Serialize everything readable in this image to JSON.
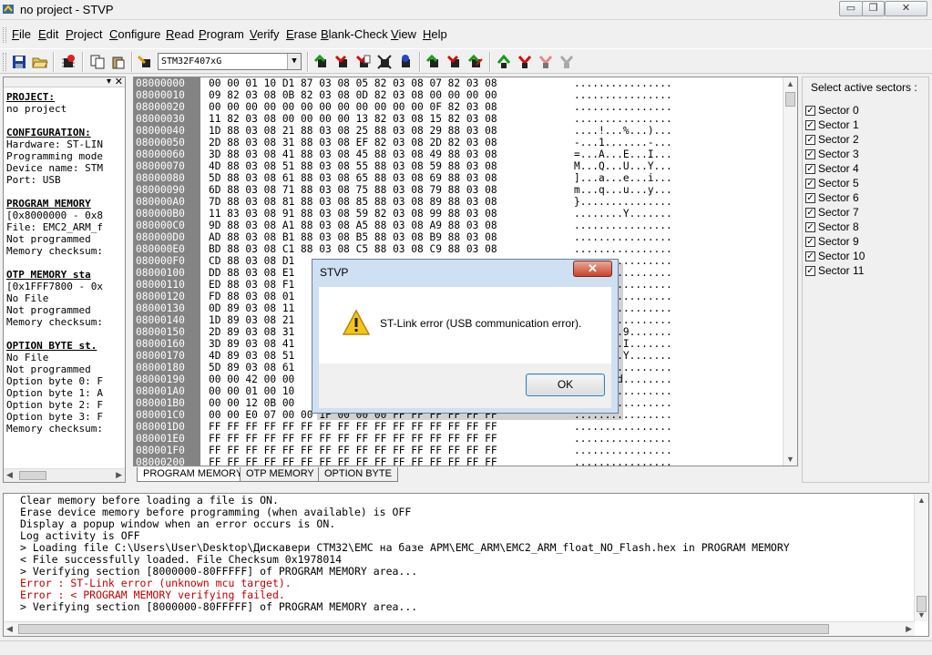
{
  "window": {
    "title": "no project - STVP",
    "min_glyph": "▭",
    "restore_glyph": "❐",
    "close_glyph": "✕"
  },
  "menu": [
    "File",
    "Edit",
    "Project",
    "Configure",
    "Read",
    "Program",
    "Verify",
    "Erase",
    "Blank-Check",
    "View",
    "Help"
  ],
  "menu_underline": [
    "F",
    "E",
    "P",
    "C",
    "R",
    "P",
    "V",
    "E",
    "B",
    "V",
    "H"
  ],
  "toolbar": {
    "device": "STM32F407xG"
  },
  "info_lines": [
    {
      "t": "PROJECT:",
      "h": true
    },
    {
      "t": "no project"
    },
    {
      "t": ""
    },
    {
      "t": "CONFIGURATION:",
      "h": true
    },
    {
      "t": "Hardware: ST-LIN"
    },
    {
      "t": "Programming mode"
    },
    {
      "t": "Device name: STM"
    },
    {
      "t": "Port: USB"
    },
    {
      "t": ""
    },
    {
      "t": "PROGRAM MEMORY",
      "h": true
    },
    {
      "t": "[0x8000000 - 0x8"
    },
    {
      "t": "File: EMC2_ARM_f"
    },
    {
      "t": "Not programmed"
    },
    {
      "t": "Memory checksum:"
    },
    {
      "t": ""
    },
    {
      "t": "OTP MEMORY sta",
      "h": true
    },
    {
      "t": "[0x1FFF7800 - 0x"
    },
    {
      "t": "No File"
    },
    {
      "t": "Not programmed"
    },
    {
      "t": "Memory checksum:"
    },
    {
      "t": ""
    },
    {
      "t": "OPTION BYTE st.",
      "h": true
    },
    {
      "t": "No File"
    },
    {
      "t": "Not programmed"
    },
    {
      "t": "Option byte 0: F"
    },
    {
      "t": "Option byte 1: A"
    },
    {
      "t": "Option byte 2: F"
    },
    {
      "t": "Option byte 3: F"
    },
    {
      "t": "Memory checksum:"
    }
  ],
  "memory": [
    {
      "a": "08000000",
      "b": "00 00 01 10 D1 87 03 08 05 82 03 08 07 82 03 08",
      "s": "................"
    },
    {
      "a": "08000010",
      "b": "09 82 03 08 0B 82 03 08 0D 82 03 08 00 00 00 00",
      "s": "................"
    },
    {
      "a": "08000020",
      "b": "00 00 00 00 00 00 00 00 00 00 00 00 0F 82 03 08",
      "s": "................"
    },
    {
      "a": "08000030",
      "b": "11 82 03 08 00 00 00 00 13 82 03 08 15 82 03 08",
      "s": "................"
    },
    {
      "a": "08000040",
      "b": "1D 88 03 08 21 88 03 08 25 88 03 08 29 88 03 08",
      "s": "....!...%...)..."
    },
    {
      "a": "08000050",
      "b": "2D 88 03 08 31 88 03 08 EF 82 03 08 2D 82 03 08",
      "s": "-...1.......-..."
    },
    {
      "a": "08000060",
      "b": "3D 88 03 08 41 88 03 08 45 88 03 08 49 88 03 08",
      "s": "=...A...E...I..."
    },
    {
      "a": "08000070",
      "b": "4D 88 03 08 51 88 03 08 55 88 03 08 59 88 03 08",
      "s": "M...Q...U...Y..."
    },
    {
      "a": "08000080",
      "b": "5D 88 03 08 61 88 03 08 65 88 03 08 69 88 03 08",
      "s": "]...a...e...i..."
    },
    {
      "a": "08000090",
      "b": "6D 88 03 08 71 88 03 08 75 88 03 08 79 88 03 08",
      "s": "m...q...u...y..."
    },
    {
      "a": "080000A0",
      "b": "7D 88 03 08 81 88 03 08 85 88 03 08 89 88 03 08",
      "s": "}..............."
    },
    {
      "a": "080000B0",
      "b": "11 83 03 08 91 88 03 08 59 82 03 08 99 88 03 08",
      "s": "........Y......."
    },
    {
      "a": "080000C0",
      "b": "9D 88 03 08 A1 88 03 08 A5 88 03 08 A9 88 03 08",
      "s": "................"
    },
    {
      "a": "080000D0",
      "b": "AD 88 03 08 B1 88 03 08 B5 88 03 08 B9 88 03 08",
      "s": "................"
    },
    {
      "a": "080000E0",
      "b": "BD 88 03 08 C1 88 03 08 C5 88 03 08 C9 88 03 08",
      "s": "................"
    },
    {
      "a": "080000F0",
      "b": "CD 88 03 08 D1",
      "s": "................"
    },
    {
      "a": "08000100",
      "b": "DD 88 03 08 E1",
      "s": "................"
    },
    {
      "a": "08000110",
      "b": "ED 88 03 08 F1",
      "s": "................"
    },
    {
      "a": "08000120",
      "b": "FD 88 03 08 01",
      "s": "................"
    },
    {
      "a": "08000130",
      "b": "0D 89 03 08 11",
      "s": "................"
    },
    {
      "a": "08000140",
      "b": "1D 89 03 08 21",
      "s": "....%..........."
    },
    {
      "a": "08000150",
      "b": "2D 89 03 08 31",
      "s": "....5...9......."
    },
    {
      "a": "08000160",
      "b": "3D 89 03 08 41",
      "s": "....E...I......."
    },
    {
      "a": "08000170",
      "b": "4D 89 03 08 51",
      "s": "....U...Y......."
    },
    {
      "a": "08000180",
      "b": "5D 89 03 08 61",
      "s": "BMbN............"
    },
    {
      "a": "08000190",
      "b": "00 00 42 00 00",
      "s": "...d...d........"
    },
    {
      "a": "080001A0",
      "b": "00 00 01 00 10",
      "s": "...bN..........."
    },
    {
      "a": "080001B0",
      "b": "00 00 12 0B 00",
      "s": "................"
    },
    {
      "a": "080001C0",
      "b": "00 00 E0 07 00 00 1F 00 00 00 FF FF FF FF FF FF",
      "s": "................"
    },
    {
      "a": "080001D0",
      "b": "FF FF FF FF FF FF FF FF FF FF FF FF FF FF FF FF",
      "s": "................"
    },
    {
      "a": "080001E0",
      "b": "FF FF FF FF FF FF FF FF FF FF FF FF FF FF FF FF",
      "s": "................"
    },
    {
      "a": "080001F0",
      "b": "FF FF FF FF FF FF FF FF FF FF FF FF FF FF FF FF",
      "s": "................"
    },
    {
      "a": "08000200",
      "b": "FF FF FF FF FF FF FF FF FF FF FF FF FF FF FF FF",
      "s": "................"
    }
  ],
  "tabs": [
    "PROGRAM MEMORY",
    "OTP MEMORY",
    "OPTION BYTE"
  ],
  "sectors": {
    "title": "Select active sectors :",
    "items": [
      "Sector 0",
      "Sector 1",
      "Sector 2",
      "Sector 3",
      "Sector 4",
      "Sector 5",
      "Sector 6",
      "Sector 7",
      "Sector 8",
      "Sector 9",
      "Sector 10",
      "Sector 11"
    ],
    "checked_glyph": "✓"
  },
  "log": [
    {
      "t": "Clear memory before loading a file is ON.",
      "e": false
    },
    {
      "t": "Erase device memory before programming (when available) is OFF",
      "e": false
    },
    {
      "t": "Display a popup window when an error occurs is ON.",
      "e": false
    },
    {
      "t": "Log activity is OFF",
      "e": false
    },
    {
      "t": "> Loading file C:\\Users\\User\\Desktop\\Дискавери СТМ32\\EMC на базе АРМ\\EMC_ARM\\EMC2_ARM_float_NO_Flash.hex in PROGRAM MEMORY",
      "e": false
    },
    {
      "t": "< File successfully loaded. File Checksum 0x1978014",
      "e": false
    },
    {
      "t": "> Verifying section [8000000-80FFFFF] of PROGRAM MEMORY area...",
      "e": false
    },
    {
      "t": "Error : ST-Link error (unknown mcu target).",
      "e": true
    },
    {
      "t": "Error : < PROGRAM MEMORY verifying failed.",
      "e": true
    },
    {
      "t": "> Verifying section [8000000-80FFFFF] of PROGRAM MEMORY area...",
      "e": false
    }
  ],
  "dialog": {
    "title": "STVP",
    "message": "ST-Link error (USB communication error).",
    "ok": "OK",
    "close_glyph": "✕"
  }
}
